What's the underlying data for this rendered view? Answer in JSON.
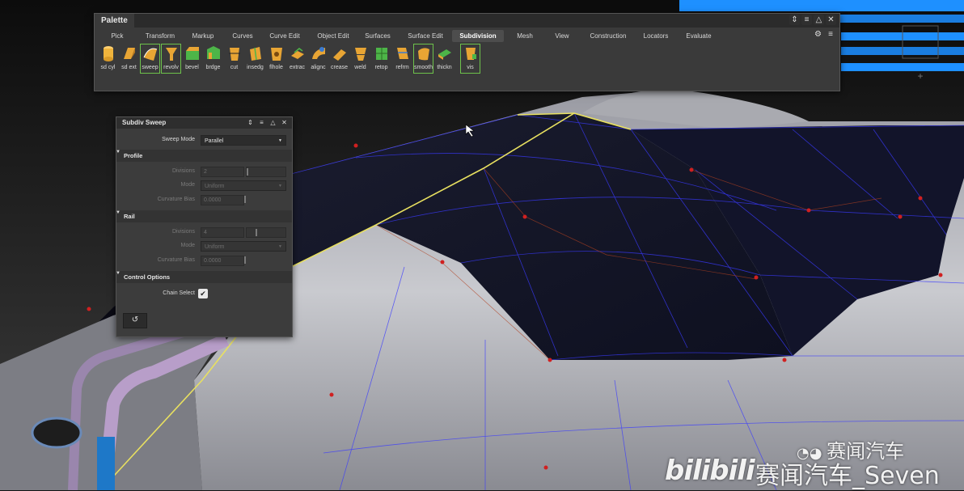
{
  "palette": {
    "title": "Palette",
    "tabs": [
      "Pick",
      "Transform",
      "Markup",
      "Curves",
      "Curve Edit",
      "Object Edit",
      "Surfaces",
      "Surface Edit",
      "Subdivision",
      "Mesh",
      "View",
      "Construction",
      "Locators",
      "Evaluate"
    ],
    "active_tab": "Subdivision",
    "tools": [
      {
        "label": "sd cyl",
        "icon": "subdiv-cylinder-icon",
        "color": "#f0b43c"
      },
      {
        "label": "sd ext",
        "icon": "subdiv-extrude-icon",
        "color": "#e8a534"
      },
      {
        "label": "sweep",
        "icon": "subdiv-sweep-icon",
        "color": "#e8a534"
      },
      {
        "label": "revolv",
        "icon": "subdiv-revolve-icon",
        "color": "#e8a534"
      },
      {
        "label": "bevel",
        "icon": "subdiv-bevel-icon",
        "color": "#4db548"
      },
      {
        "label": "brdge",
        "icon": "subdiv-bridge-icon",
        "color": "#4db548"
      },
      {
        "label": "cut",
        "icon": "subdiv-cut-icon",
        "color": "#e8a534"
      },
      {
        "label": "insedg",
        "icon": "insert-edge-icon",
        "color": "#e8a534"
      },
      {
        "label": "flhole",
        "icon": "fill-hole-icon",
        "color": "#e8a534"
      },
      {
        "label": "extrac",
        "icon": "extract-icon",
        "color": "#e8a534"
      },
      {
        "label": "alignc",
        "icon": "align-curve-icon",
        "color": "#e8a534"
      },
      {
        "label": "crease",
        "icon": "crease-icon",
        "color": "#e8a534"
      },
      {
        "label": "weld",
        "icon": "weld-icon",
        "color": "#e8a534"
      },
      {
        "label": "retop",
        "icon": "retopology-icon",
        "color": "#4db548"
      },
      {
        "label": "refrm",
        "icon": "reform-icon",
        "color": "#e8a534"
      },
      {
        "label": "smooth",
        "icon": "smooth-icon",
        "color": "#e8a534"
      },
      {
        "label": "thickn",
        "icon": "thicken-icon",
        "color": "#4db548"
      },
      {
        "label": "vis",
        "icon": "visibility-icon",
        "color": "#e8a534"
      }
    ],
    "highlighted_tools": [
      "sweep",
      "revolv",
      "smooth",
      "vis"
    ]
  },
  "sweep_panel": {
    "title": "Subdiv Sweep",
    "sweep_mode_label": "Sweep Mode",
    "sweep_mode_value": "Parallel",
    "profile_section": "Profile",
    "profile_divisions_label": "Divisions",
    "profile_divisions_value": "2",
    "profile_mode_label": "Mode",
    "profile_mode_value": "Uniform",
    "profile_bias_label": "Curvature Bias",
    "profile_bias_value": "0.0000",
    "rail_section": "Rail",
    "rail_divisions_label": "Divisions",
    "rail_divisions_value": "4",
    "rail_mode_label": "Mode",
    "rail_mode_value": "Uniform",
    "rail_bias_label": "Curvature Bias",
    "rail_bias_value": "0.0000",
    "control_section": "Control Options",
    "chain_select_label": "Chain Select",
    "chain_select_checked": true
  },
  "watermarks": {
    "wechat": "赛闻汽车",
    "bilibili_logo": "bilibili",
    "bilibili_user": "赛闻汽车_Seven"
  },
  "colors": {
    "ui_bg": "#3a3a3a",
    "highlight": "#6dc24b",
    "curve_yellow": "#e8e060",
    "wire_blue": "#3a3aff",
    "point_red": "#d02020"
  }
}
